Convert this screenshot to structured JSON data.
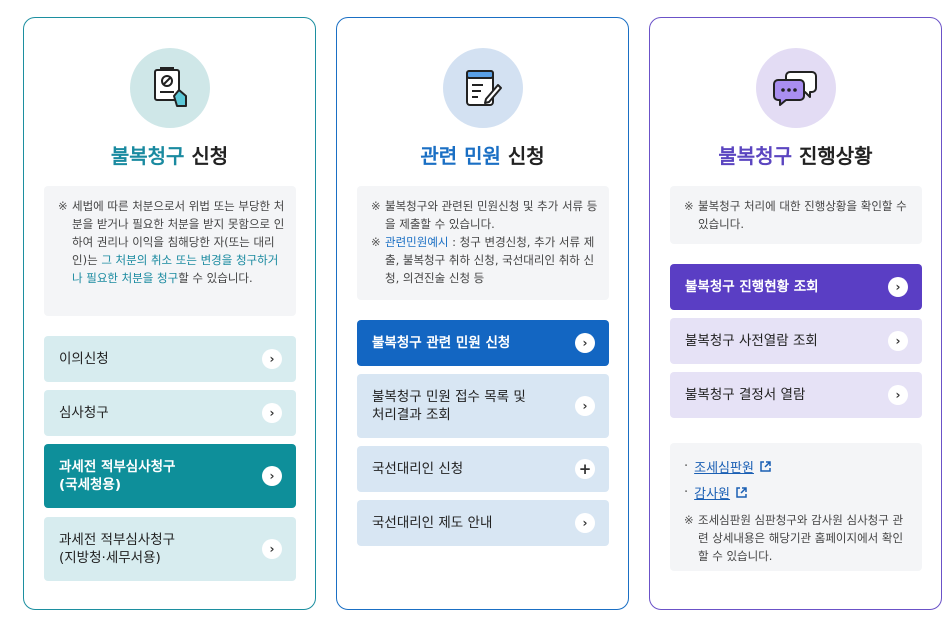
{
  "cards": [
    {
      "title_accent": "불복청구",
      "title_rest": " 신청",
      "notice": {
        "mark": "※",
        "text1": "세법에 따른 처분으로서 위법 또는 부당한 처분을 받거나 필요한 처분을 받지 못함으로 인하여 권리나 이익을 침해당한 자(또는 대리인)는 ",
        "highlight": "그 처분의 취소 또는 변경을 청구하거나 필요한 처분을 청구",
        "text2": "할 수 있습니다."
      },
      "buttons": [
        {
          "label": "이의신청",
          "icon": "chevron-right-icon"
        },
        {
          "label": "심사청구",
          "icon": "chevron-right-icon"
        },
        {
          "label": "과세전 적부심사청구\n(국세청용)",
          "icon": "chevron-right-icon"
        },
        {
          "label": "과세전 적부심사청구\n(지방청·세무서용)",
          "icon": "chevron-right-icon"
        }
      ]
    },
    {
      "title_accent": "관련 민원",
      "title_rest": " 신청",
      "notice": {
        "mark": "※",
        "line1": "불복청구와 관련된 민원신청 및 추가 서류 등을 제출할 수 있습니다.",
        "example_label": "관련민원예시",
        "example_text": " : 청구 변경신청, 추가 서류 제출, 불복청구 취하 신청, 국선대리인 취하 신청, 의견진술 신청 등"
      },
      "buttons": [
        {
          "label": "불복청구 관련 민원 신청",
          "icon": "chevron-right-icon"
        },
        {
          "label": "불복청구 민원 접수 목록 및\n처리결과 조회",
          "icon": "chevron-right-icon"
        },
        {
          "label": "국선대리인 신청",
          "icon": "plus-icon"
        },
        {
          "label": "국선대리인 제도 안내",
          "icon": "chevron-right-icon"
        }
      ]
    },
    {
      "title_accent": "불복청구",
      "title_rest": " 진행상황",
      "notice": {
        "mark": "※",
        "text": "불복청구 처리에 대한 진행상황을 확인할 수 있습니다."
      },
      "buttons": [
        {
          "label": "불복청구 진행현황 조회",
          "icon": "chevron-right-icon"
        },
        {
          "label": "불복청구 사전열람 조회",
          "icon": "chevron-right-icon"
        },
        {
          "label": "불복청구 결정서 열람",
          "icon": "chevron-right-icon"
        }
      ],
      "links": [
        {
          "bullet": "·",
          "label": "조세심판원"
        },
        {
          "bullet": "·",
          "label": "감사원"
        }
      ],
      "links_note": {
        "mark": "※",
        "text": "조세심판원 심판청구와 감사원 심사청구 관련 상세내용은 해당기관 홈페이지에서 확인할 수 있습니다."
      }
    }
  ],
  "colors": {
    "teal": "#0e8f9a",
    "blue": "#1366c2",
    "purple": "#5a3ec4"
  }
}
